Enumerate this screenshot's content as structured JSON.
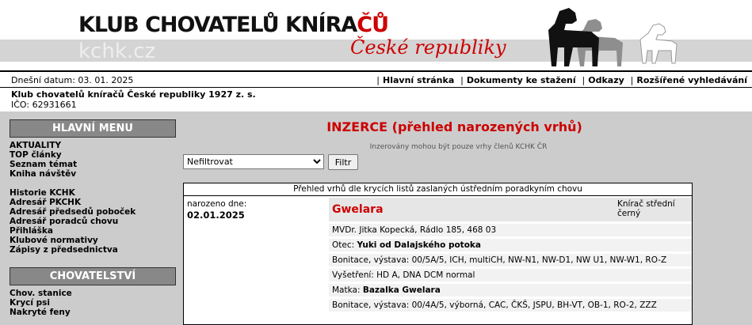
{
  "header": {
    "title_main": "KLUB CHOVATELŮ KNÍRA",
    "title_accent": "ČŮ",
    "subtitle": "České republiky",
    "watermark": "kchk.cz"
  },
  "datebar": {
    "date_label": "Dnešní datum: 03. 01. 2025",
    "links": [
      "Hlavní stránka",
      "Dokumenty ke stažení",
      "Odkazy",
      "Rozšířené vyhledávání"
    ]
  },
  "club": {
    "name": "Klub chovatelů kníračů České republiky 1927 z. s.",
    "ico": "IČO: 62931661"
  },
  "sidebar": {
    "main_menu_title": "HLAVNÍ MENU",
    "main_menu": [
      "AKTUALITY",
      "TOP články",
      "Seznam témat",
      "Kniha návštěv"
    ],
    "main_menu_2": [
      "Historie KCHK",
      "Adresář PKCHK",
      "Adresář předsedů poboček",
      "Adresář poradců chovu",
      "Přihláška",
      "Klubové normativy",
      "Zápisy z předsednictva"
    ],
    "breeding_title": "CHOVATELSTVÍ",
    "breeding_menu": [
      "Chov. stanice",
      "Krycí psi",
      "Nakryté feny"
    ]
  },
  "main": {
    "heading": "INZERCE (přehled narozených vrhů)",
    "note": "Inzerovány mohou být pouze vrhy členů KCHK ČR",
    "filter_value": "Nefiltrovat",
    "filter_button": "Filtr",
    "listing_caption": "Přehled vrhů dle krycích listů zaslaných ústředním poradkyním chovu",
    "born_label": "narozeno dne:",
    "born_date": "02.01.2025",
    "kennel": "Gwelara",
    "breed": "Knírač střední černý",
    "owner": "MVDr. Jitka Kopecká, Rádlo 185, 468 03",
    "sire_label": "Otec:",
    "sire": "Yuki od Dalajského potoka",
    "sire_titles": "Bonitace, výstava: 00/5A/5, ICH, multiCH, NW-N1, NW-D1, NW U1, NW-W1, RO-Z",
    "sire_exam": "Vyšetření: HD A, DNA DCM normal",
    "dam_label": "Matka:",
    "dam": "Bazalka Gwelara",
    "dam_titles": "Bonitace, výstava: 00/4A/5, výborná, CAC, ČKŠ, JSPU, BH-VT, OB-1, RO-2, ZZZ"
  }
}
